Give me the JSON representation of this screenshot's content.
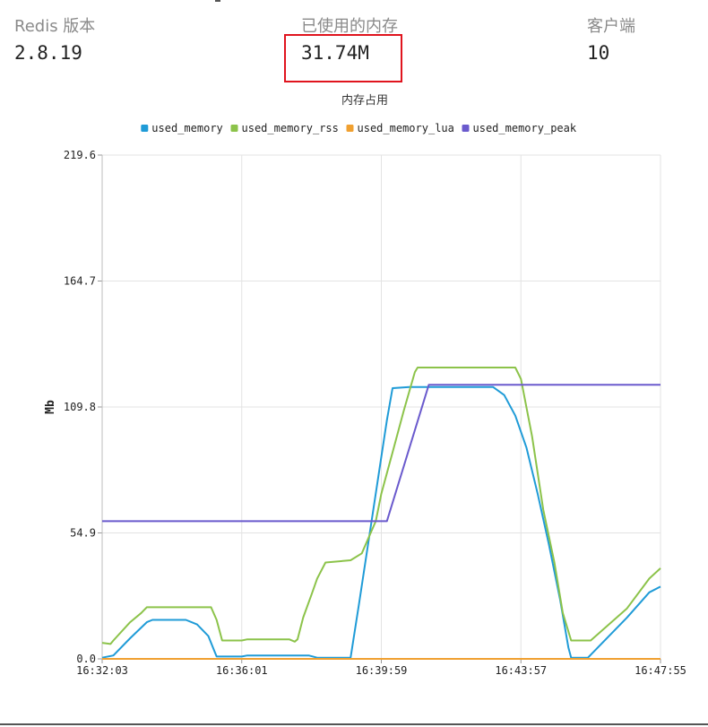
{
  "stats": {
    "version_label": "Redis 版本",
    "version_value": "2.8.19",
    "memory_label": "已使用的内存",
    "memory_value": "31.74M",
    "clients_label": "客户端",
    "clients_value": "10"
  },
  "colors": {
    "used_memory": "#1f9bd7",
    "used_memory_rss": "#8cc34a",
    "used_memory_lua": "#f0a030",
    "used_memory_peak": "#6a5acd",
    "highlight": "#e0141e"
  },
  "chart_data": {
    "type": "line",
    "title": "内存占用",
    "xlabel": "",
    "ylabel": "Mb",
    "ylim": [
      0,
      219.6
    ],
    "yticks": [
      "0.0",
      "54.9",
      "109.8",
      "164.7",
      "219.6"
    ],
    "xticks": [
      "16:32:03",
      "16:36:01",
      "16:39:59",
      "16:43:57",
      "16:47:55"
    ],
    "legend_position": "top",
    "grid": true,
    "series": [
      {
        "name": "used_memory",
        "points": [
          [
            0,
            0.5
          ],
          [
            0.02,
            1.5
          ],
          [
            0.05,
            9
          ],
          [
            0.08,
            16
          ],
          [
            0.09,
            17
          ],
          [
            0.15,
            17
          ],
          [
            0.17,
            15
          ],
          [
            0.19,
            10
          ],
          [
            0.2,
            4
          ],
          [
            0.205,
            1
          ],
          [
            0.25,
            1
          ],
          [
            0.26,
            1.5
          ],
          [
            0.37,
            1.5
          ],
          [
            0.385,
            0.5
          ],
          [
            0.445,
            0.5
          ],
          [
            0.46,
            24
          ],
          [
            0.51,
            104
          ],
          [
            0.52,
            118
          ],
          [
            0.55,
            118.5
          ],
          [
            0.7,
            118.5
          ],
          [
            0.72,
            115
          ],
          [
            0.74,
            106
          ],
          [
            0.76,
            92
          ],
          [
            0.78,
            72
          ],
          [
            0.8,
            50
          ],
          [
            0.82,
            26
          ],
          [
            0.835,
            5
          ],
          [
            0.84,
            0.5
          ],
          [
            0.87,
            0.5
          ],
          [
            0.94,
            18
          ],
          [
            0.98,
            29
          ],
          [
            1.0,
            31.5
          ]
        ]
      },
      {
        "name": "used_memory_rss",
        "points": [
          [
            0,
            7
          ],
          [
            0.015,
            6.5
          ],
          [
            0.02,
            8
          ],
          [
            0.05,
            16
          ],
          [
            0.07,
            20
          ],
          [
            0.08,
            22.5
          ],
          [
            0.195,
            22.5
          ],
          [
            0.205,
            17
          ],
          [
            0.215,
            8
          ],
          [
            0.25,
            8
          ],
          [
            0.26,
            8.5
          ],
          [
            0.335,
            8.5
          ],
          [
            0.345,
            7.5
          ],
          [
            0.35,
            8.5
          ],
          [
            0.36,
            18
          ],
          [
            0.375,
            28
          ],
          [
            0.385,
            35
          ],
          [
            0.4,
            42
          ],
          [
            0.445,
            43
          ],
          [
            0.465,
            46
          ],
          [
            0.49,
            60
          ],
          [
            0.5,
            72
          ],
          [
            0.52,
            90
          ],
          [
            0.54,
            108
          ],
          [
            0.56,
            125
          ],
          [
            0.565,
            127
          ],
          [
            0.74,
            127
          ],
          [
            0.75,
            122
          ],
          [
            0.77,
            97
          ],
          [
            0.79,
            65
          ],
          [
            0.81,
            42
          ],
          [
            0.825,
            20
          ],
          [
            0.84,
            8
          ],
          [
            0.875,
            8
          ],
          [
            0.94,
            22
          ],
          [
            0.98,
            35
          ],
          [
            1.0,
            39.5
          ]
        ]
      },
      {
        "name": "used_memory_lua",
        "points": [
          [
            0,
            0
          ],
          [
            1.0,
            0
          ]
        ]
      },
      {
        "name": "used_memory_peak",
        "points": [
          [
            0,
            60
          ],
          [
            0.51,
            60
          ],
          [
            0.585,
            119.5
          ],
          [
            1.0,
            119.5
          ]
        ]
      }
    ]
  }
}
